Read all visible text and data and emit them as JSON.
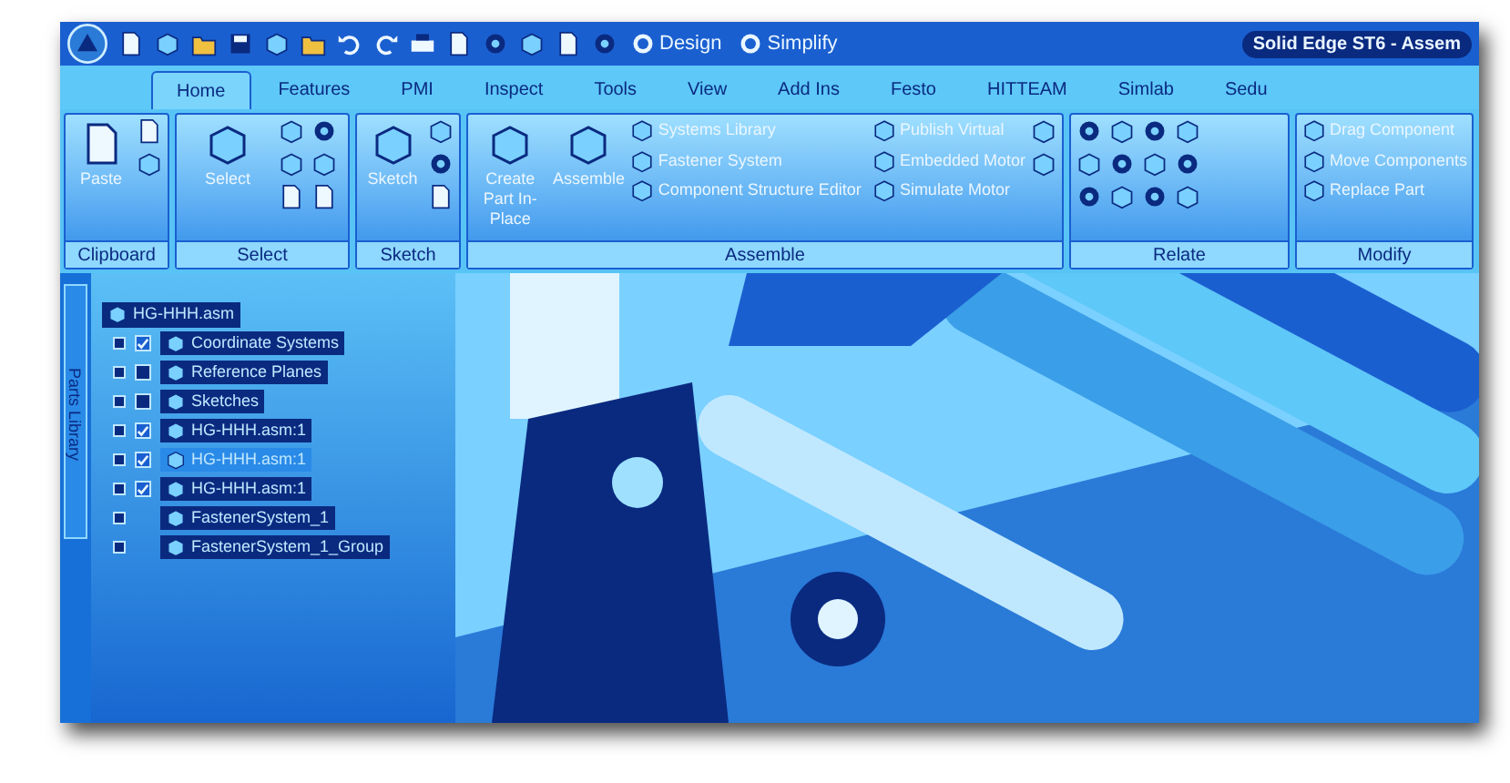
{
  "window": {
    "title": "Solid Edge ST6 - Assem"
  },
  "quick_access": {
    "buttons": [
      "Design",
      "Simplify"
    ]
  },
  "tabs": [
    {
      "label": "Home",
      "selected": true
    },
    {
      "label": "Features",
      "selected": false
    },
    {
      "label": "PMI",
      "selected": false
    },
    {
      "label": "Inspect",
      "selected": false
    },
    {
      "label": "Tools",
      "selected": false
    },
    {
      "label": "View",
      "selected": false
    },
    {
      "label": "Add Ins",
      "selected": false
    },
    {
      "label": "Festo",
      "selected": false
    },
    {
      "label": "HITTEAM",
      "selected": false
    },
    {
      "label": "Simlab",
      "selected": false
    },
    {
      "label": "Sedu",
      "selected": false
    }
  ],
  "ribbon": {
    "groups": [
      {
        "label": "Clipboard",
        "large": [
          "Paste"
        ]
      },
      {
        "label": "Select",
        "large": [
          "Select"
        ]
      },
      {
        "label": "Sketch",
        "large": [
          "Sketch"
        ]
      },
      {
        "label": "Assemble",
        "large": [
          "Create Part In-Place",
          "Assemble"
        ],
        "commands": [
          "Systems Library",
          "Fastener System",
          "Component Structure Editor",
          "Publish Virtual",
          "Embedded Motor",
          "Simulate Motor"
        ]
      },
      {
        "label": "Relate"
      },
      {
        "label": "Modify",
        "commands": [
          "Drag Component",
          "Move Components",
          "Replace Part"
        ]
      }
    ]
  },
  "side_tab": {
    "label": "Parts Library"
  },
  "tree": {
    "root": "HG-HHH.asm",
    "items": [
      {
        "label": "Coordinate Systems",
        "kind": "checkbox",
        "checked": true,
        "selected": false
      },
      {
        "label": "Reference Planes",
        "kind": "checkbox",
        "checked": false,
        "selected": false
      },
      {
        "label": "Sketches",
        "kind": "checkbox",
        "checked": false,
        "selected": false
      },
      {
        "label": "HG-HHH.asm:1",
        "kind": "checkbox",
        "checked": true,
        "selected": false
      },
      {
        "label": "HG-HHH.asm:1",
        "kind": "checkbox",
        "checked": true,
        "selected": true
      },
      {
        "label": "HG-HHH.asm:1",
        "kind": "checkbox",
        "checked": true,
        "selected": false
      },
      {
        "label": "FastenerSystem_1",
        "kind": "plain",
        "selected": false
      },
      {
        "label": "FastenerSystem_1_Group",
        "kind": "plain",
        "selected": false
      }
    ]
  }
}
